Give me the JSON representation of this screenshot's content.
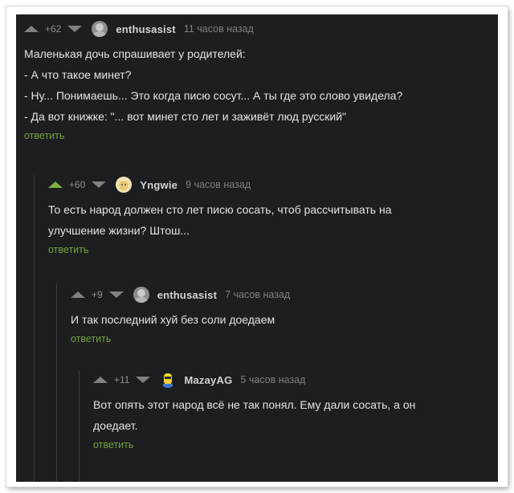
{
  "comments": [
    {
      "rating": "+62",
      "author": "enthusasist",
      "time": "11 часов назад",
      "lines": [
        "Маленькая дочь спрашивает у родителей:",
        "- А что такое минет?",
        "- Ну... Понимаешь... Это когда писю сосут... А ты где это слово увидела?",
        "- Да вот книжке: \"... вот минет сто лет и  заживёт люд русский\""
      ],
      "reply": "ответить"
    },
    {
      "rating": "+60",
      "author": "Yngwie",
      "time": "9 часов назад",
      "lines": [
        "То есть народ должен сто лет писю сосать, чтоб рассчитывать на",
        "улучшение жизни? Штош..."
      ],
      "reply": "ответить"
    },
    {
      "rating": "+9",
      "author": "enthusasist",
      "time": "7 часов назад",
      "lines": [
        "И так последний хуй без соли доедаем"
      ],
      "reply": "ответить"
    },
    {
      "rating": "+11",
      "author": "MazayAG",
      "time": "5 часов назад",
      "lines": [
        "Вот опять этот народ всё не так понял. Ему дали сосать, а он",
        "доедает."
      ],
      "reply": "ответить"
    }
  ],
  "colors": {
    "background": "#1d1e20",
    "text": "#e3e4e6",
    "meta": "#8b8e93",
    "reply": "#74a23e",
    "upvote_active": "#7fb040"
  }
}
